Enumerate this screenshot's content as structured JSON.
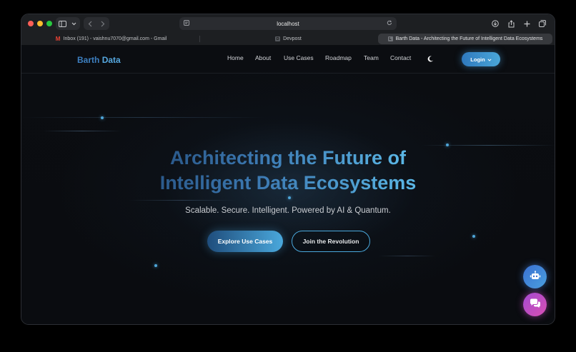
{
  "browser": {
    "address": "localhost",
    "tabs": [
      {
        "label": "Inbox (191) - vaishnu7070@gmail.com - Gmail",
        "icon": "gmail-icon"
      },
      {
        "label": "Devpost",
        "icon": "devpost-icon"
      },
      {
        "label": "Barth Data - Architecting the Future of Intelligent Data Ecosystems",
        "icon": "barth-data-icon"
      }
    ]
  },
  "nav": {
    "brand_primary": "Barth",
    "brand_secondary": "Data",
    "links": [
      "Home",
      "About",
      "Use Cases",
      "Roadmap",
      "Team",
      "Contact"
    ],
    "login": "Login"
  },
  "hero": {
    "headline_line1": "Architecting the Future of",
    "headline_line2": "Intelligent Data Ecosystems",
    "subtitle": "Scalable. Secure. Intelligent. Powered by AI & Quantum.",
    "primary_cta": "Explore Use Cases",
    "secondary_cta": "Join the Revolution"
  },
  "colors": {
    "accent": "#4aa8dc",
    "brand_blue": "#3d7fc0",
    "chat_fab": "#c04fc4",
    "background": "#0a0c10"
  }
}
